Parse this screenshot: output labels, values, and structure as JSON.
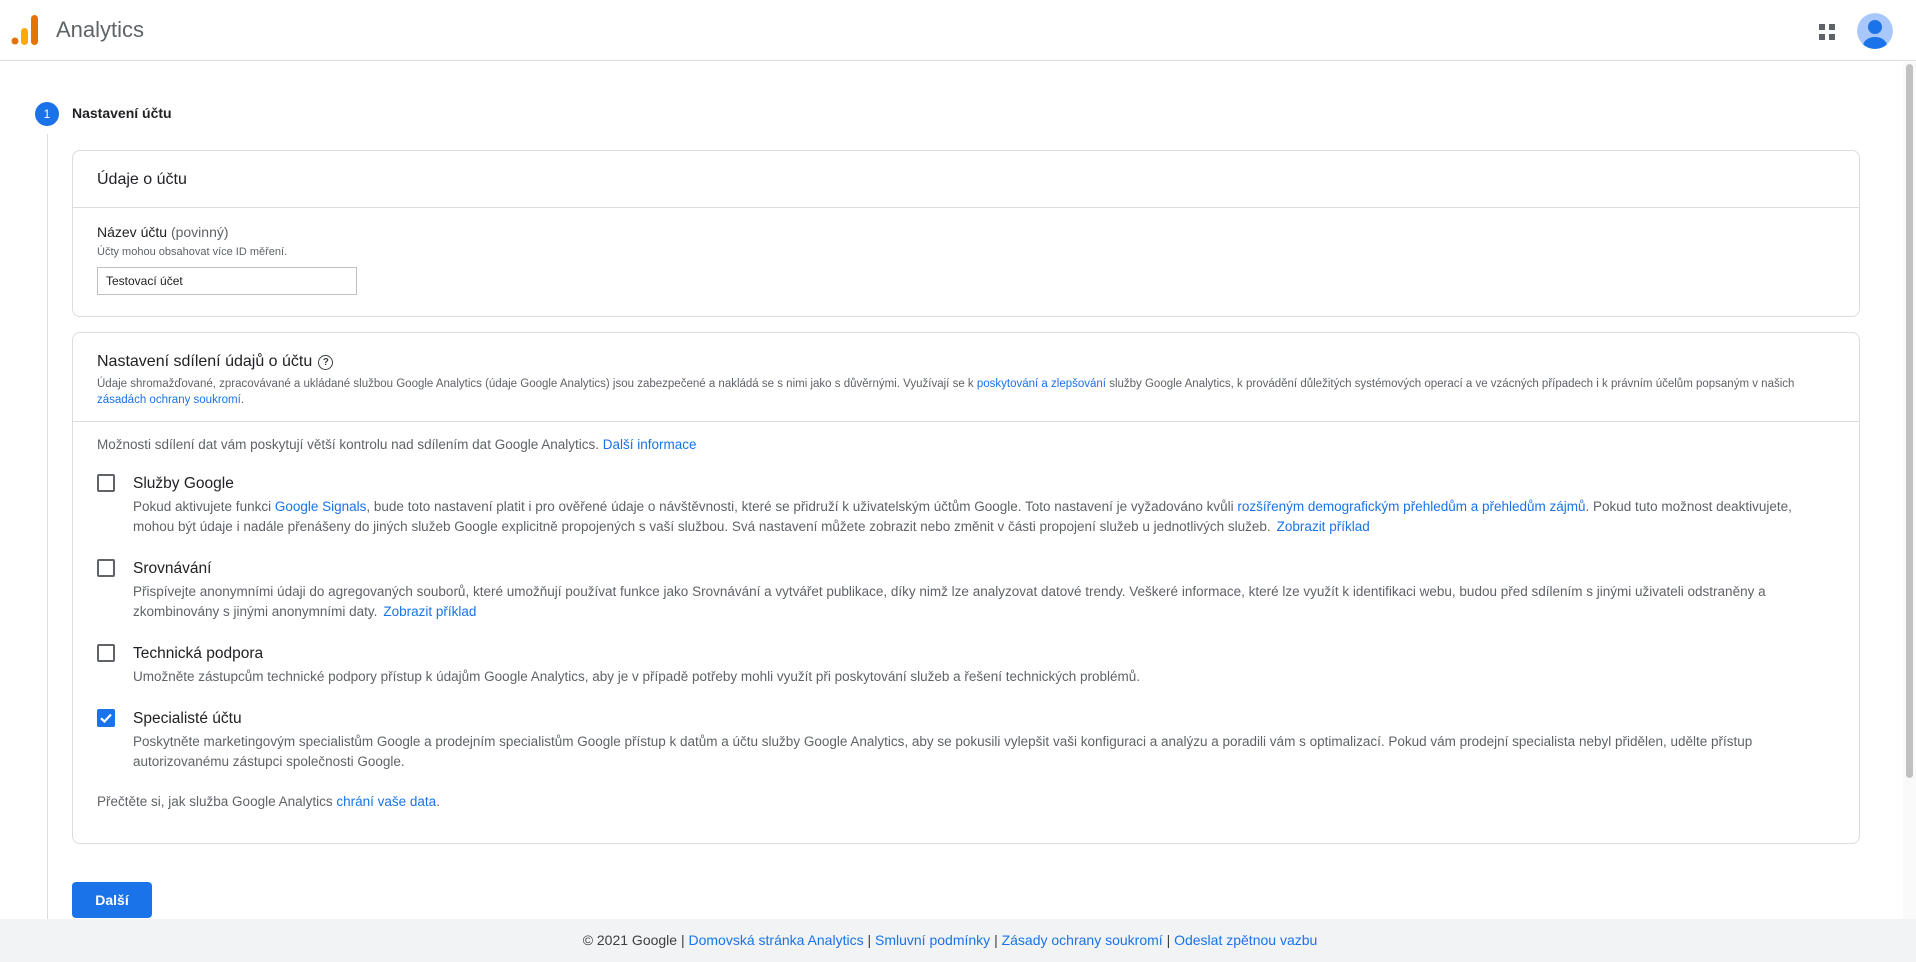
{
  "app": {
    "title": "Analytics"
  },
  "header": {
    "apps_icon": "apps-grid-icon",
    "avatar_icon": "account-avatar-icon"
  },
  "step": {
    "number": "1",
    "title": "Nastavení účtu"
  },
  "account_details": {
    "heading": "Údaje o účtu",
    "name_label": "Název účtu",
    "name_optional": "(povinný)",
    "name_hint": "Účty mohou obsahovat více ID měření.",
    "name_value": "Testovací účet"
  },
  "sharing": {
    "title": "Nastavení sdílení údajů o účtu",
    "help_icon": "?",
    "desc_part1": "Údaje shromažďované, zpracovávané a ukládané službou Google Analytics (údaje Google Analytics) jsou zabezpečené a nakládá se s nimi jako s důvěrnými. Využívají se k ",
    "desc_link1": "poskytování a zlepšování",
    "desc_part2": " služby Google Analytics, k provádění důležitých systémových operací a ve vzácných případech i k právním účelům popsaným v našich ",
    "desc_link2": "zásadách ochrany soukromí",
    "desc_part3": ".",
    "intro_text": "Možnosti sdílení dat vám poskytují větší kontrolu nad sdílením dat Google Analytics. ",
    "intro_link": "Další informace",
    "options": [
      {
        "title": "Služby Google",
        "checked": false,
        "desc_a": "Pokud aktivujete funkci ",
        "link_a": "Google Signals",
        "desc_b": ", bude toto nastavení platit i pro ověřené údaje o návštěvnosti, které se přidruží k uživatelským účtům Google. Toto nastavení je vyžadováno kvůli ",
        "link_b": "rozšířeným demografickým přehledům a přehledům zájmů",
        "desc_c": ". Pokud tuto možnost deaktivujete, mohou být údaje i nadále přenášeny do jiných služeb Google explicitně propojených s vaší službou. Svá nastavení můžete zobrazit nebo změnit v části propojení služeb u jednotlivých služeb.",
        "example": "Zobrazit příklad"
      },
      {
        "title": "Srovnávání",
        "checked": false,
        "desc": "Přispívejte anonymními údaji do agregovaných souborů, které umožňují používat funkce jako Srovnávání a vytvářet publikace, díky nimž lze analyzovat datové trendy. Veškeré informace, které lze využít k identifikaci webu, budou před sdílením s jinými uživateli odstraněny a zkombinovány s jinými anonymními daty.",
        "example": "Zobrazit příklad"
      },
      {
        "title": "Technická podpora",
        "checked": false,
        "desc": "Umožněte zástupcům technické podpory přístup k údajům Google Analytics, aby je v případě potřeby mohli využít při poskytování služeb a řešení technických problémů."
      },
      {
        "title": "Specialisté účtu",
        "checked": true,
        "desc": "Poskytněte marketingovým specialistům Google a prodejním specialistům Google přístup k datům a účtu služby Google Analytics, aby se pokusili vylepšit vaši konfiguraci a analýzu a poradili vám s optimalizací. Pokud vám prodejní specialista nebyl přidělen, udělte přístup autorizovanému zástupci společnosti Google."
      }
    ],
    "footnote_text": "Přečtěte si, jak služba Google Analytics ",
    "footnote_link": "chrání vaše data",
    "footnote_end": "."
  },
  "next_button": "Další",
  "footer": {
    "copyright": "© 2021 Google",
    "links": [
      "Domovská stránka Analytics",
      "Smluvní podmínky",
      "Zásady ochrany soukromí",
      "Odeslat zpětnou vazbu"
    ]
  },
  "colors": {
    "accent": "#1a73e8",
    "border": "#dadce0",
    "footer_bg": "#f1f3f4"
  }
}
